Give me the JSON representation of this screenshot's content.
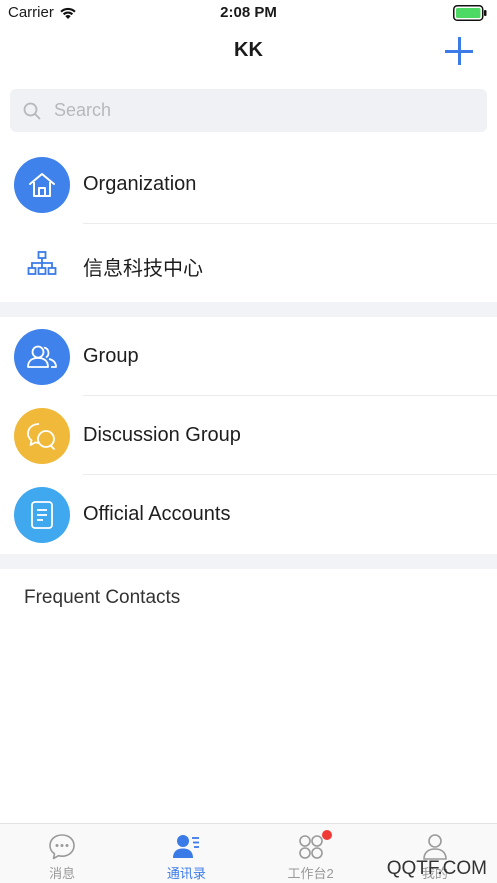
{
  "status_bar": {
    "carrier": "Carrier",
    "time": "2:08 PM"
  },
  "nav": {
    "title": "KK"
  },
  "search": {
    "placeholder": "Search"
  },
  "rows": {
    "organization": "Organization",
    "department": "信息科技中心",
    "group": "Group",
    "discussion_group": "Discussion Group",
    "official_accounts": "Official Accounts"
  },
  "frequent_contacts": {
    "title": "Frequent Contacts"
  },
  "tabs": [
    {
      "label": "消息",
      "icon": "chat-bubble-icon"
    },
    {
      "label": "通讯录",
      "icon": "contacts-icon"
    },
    {
      "label": "工作台2",
      "icon": "grid-icon"
    },
    {
      "label": "我的",
      "icon": "profile-icon"
    }
  ],
  "watermark": "QQTF.COM",
  "colors": {
    "accent": "#3a7be8",
    "org_icon_bg": "#3f82ec",
    "group_icon_bg": "#3f82ec",
    "discussion_icon_bg": "#f0b93a",
    "official_icon_bg": "#3fa8ee",
    "badge": "#f03a36"
  }
}
